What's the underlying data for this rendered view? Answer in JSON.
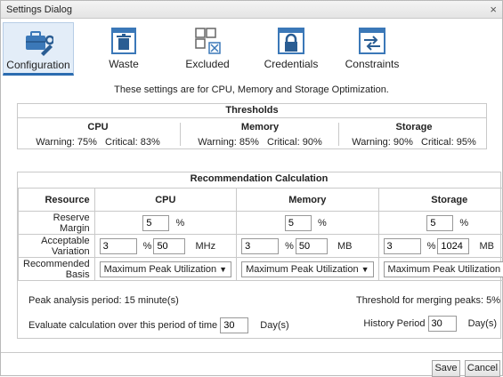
{
  "window": {
    "title": "Settings Dialog",
    "close_glyph": "×"
  },
  "toolbar": {
    "items": [
      {
        "label": "Configuration",
        "icon": "configuration-tools-icon",
        "active": true
      },
      {
        "label": "Waste",
        "icon": "trash-icon",
        "active": false
      },
      {
        "label": "Excluded",
        "icon": "excluded-grid-icon",
        "active": false
      },
      {
        "label": "Credentials",
        "icon": "lock-icon",
        "active": false
      },
      {
        "label": "Constraints",
        "icon": "arrows-icon",
        "active": false
      }
    ]
  },
  "intro": "These settings are for CPU, Memory and Storage Optimization.",
  "thresholds": {
    "title": "Thresholds",
    "cpu": {
      "title": "CPU",
      "warning": "Warning: 75%",
      "critical": "Critical: 83%"
    },
    "memory": {
      "title": "Memory",
      "warning": "Warning: 85%",
      "critical": "Critical: 90%"
    },
    "storage": {
      "title": "Storage",
      "warning": "Warning: 90%",
      "critical": "Critical: 95%"
    }
  },
  "recommendation": {
    "title": "Recommendation Calculation",
    "headers": {
      "resource": "Resource",
      "cpu": "CPU",
      "memory": "Memory",
      "storage": "Storage"
    },
    "reserve_margin": {
      "label": "Reserve Margin",
      "cpu": "5",
      "memory": "5",
      "storage": "5",
      "unit": "%"
    },
    "acceptable_variation": {
      "label": "Acceptable Variation",
      "pct_unit": "%",
      "cpu": {
        "pct": "3",
        "abs": "50",
        "unit": "MHz"
      },
      "memory": {
        "pct": "3",
        "abs": "50",
        "unit": "MB"
      },
      "storage": {
        "pct": "3",
        "abs": "1024",
        "unit": "MB"
      }
    },
    "recommended_basis": {
      "label": "Recommended Basis",
      "arrow": "▼",
      "cpu": "Maximum Peak Utilization",
      "memory": "Maximum Peak Utilization",
      "storage": "Maximum Peak Utilization"
    },
    "peak_period": "Peak analysis period: 15 minute(s)",
    "merge_threshold": "Threshold for merging peaks: 5%",
    "evaluate_label": "Evaluate calculation over this period of time",
    "evaluate_value": "30",
    "evaluate_unit": "Day(s)",
    "history_label": "History Period",
    "history_value": "30",
    "history_unit": "Day(s)"
  },
  "buttons": {
    "save": "Save",
    "cancel": "Cancel"
  },
  "colors": {
    "accent": "#2b6cb0",
    "icon_blue": "#3b78b8",
    "active_bg": "#e3edf8"
  }
}
